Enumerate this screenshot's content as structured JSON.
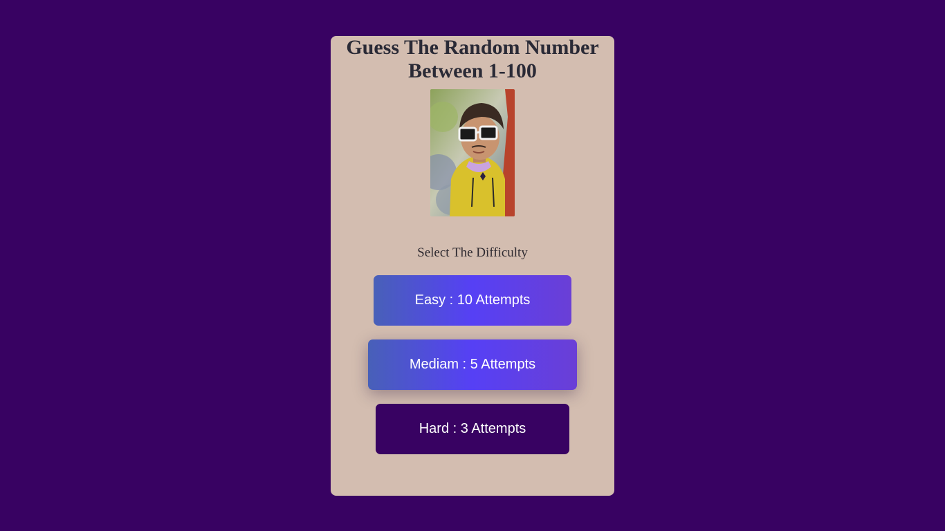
{
  "title": {
    "line1": "Guess The Random Number",
    "line2": "Between 1-100"
  },
  "photo": {
    "alt": "profile photo"
  },
  "difficulty": {
    "label": "Select The Difficulty",
    "options": [
      {
        "label": "Easy : 10 Attempts"
      },
      {
        "label": "Mediam : 5 Attempts"
      },
      {
        "label": "Hard : 3 Attempts"
      }
    ]
  },
  "colors": {
    "page_background": "#380262",
    "card_background": "#d3bdb0",
    "button_gradient_start": "#4860b8",
    "button_gradient_mid": "#5640f5",
    "button_gradient_end": "#6a3fd6",
    "hard_button": "#380262"
  }
}
